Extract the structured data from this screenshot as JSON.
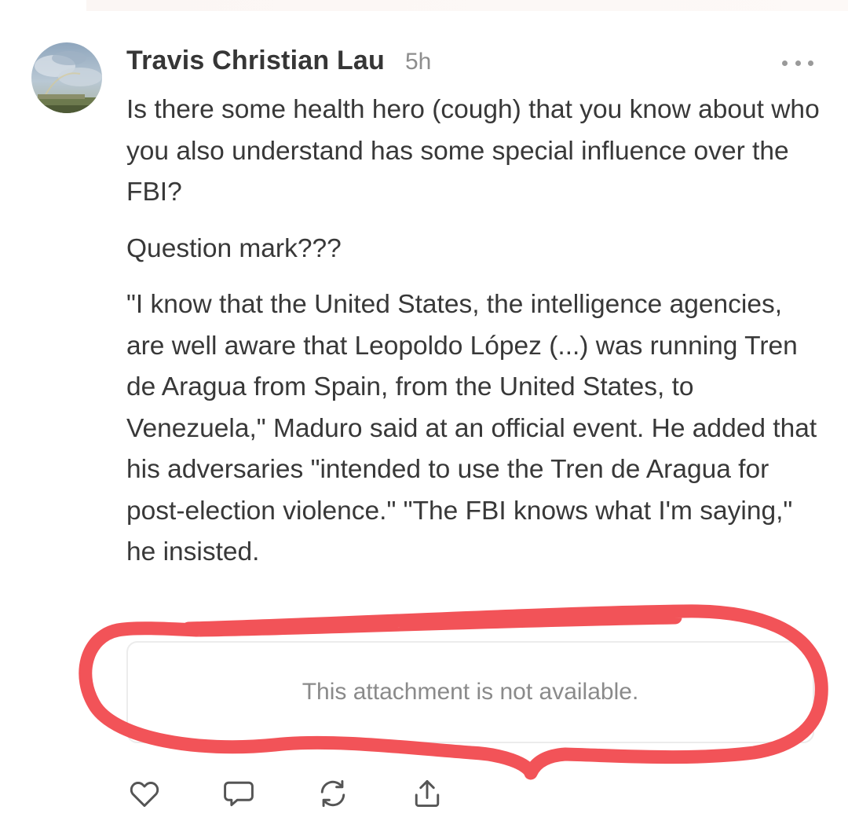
{
  "post": {
    "author": "Travis Christian Lau",
    "timestamp": "5h",
    "paragraphs": [
      "Is there some health hero (cough) that you know about who you also understand has some special influence over the FBI?",
      "Question mark???",
      "\"I know that the United States, the intelligence agencies, are well aware that Leopoldo López (...) was running Tren de Aragua from Spain, from the United States, to Venezuela,\" Maduro said at an official event. He added that his adversaries \"intended to use the Tren de Aragua for post-election violence.\" \"The FBI knows what I'm saying,\" he insisted."
    ],
    "attachment_message": "This attachment is not available."
  },
  "actions": [
    "heart-icon",
    "comment-icon",
    "restack-icon",
    "share-icon"
  ],
  "colors": {
    "annotation_stroke": "#f25358",
    "text": "#383838",
    "muted": "#8d8d8d",
    "icon": "#555555"
  }
}
